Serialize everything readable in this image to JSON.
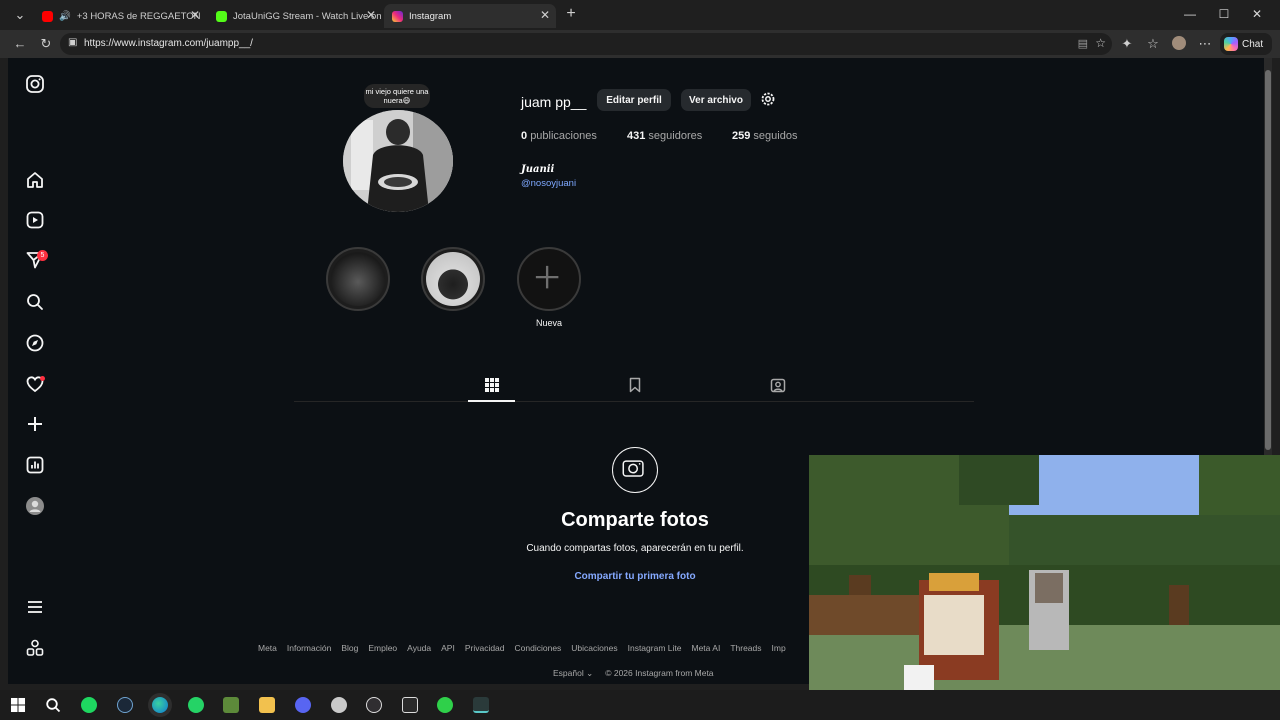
{
  "browser": {
    "tabs": [
      {
        "title": "+3 HORAS de REGGAETON",
        "active": false
      },
      {
        "title": "JotaUniGG Stream - Watch Live on",
        "active": false
      },
      {
        "title": "Instagram",
        "active": true
      }
    ],
    "url": "https://www.instagram.com/juampp__/",
    "chat_label": "Chat"
  },
  "sidebar": {
    "notification_count": "5",
    "items": [
      "instagram-logo",
      "home",
      "reels",
      "messages",
      "search",
      "explore",
      "notifications",
      "create",
      "dashboard",
      "profile",
      "more",
      "also-from-meta"
    ]
  },
  "profile": {
    "note": "mi viejo quiere una nuera😄",
    "username": "juam pp__",
    "edit_label": "Editar perfil",
    "archive_label": "Ver archivo",
    "stats": {
      "posts_count": "0",
      "posts_label": "publicaciones",
      "followers_count": "431",
      "followers_label": "seguidores",
      "following_count": "259",
      "following_label": "seguidos"
    },
    "full_name": "𝑱𝒖𝒂𝒏𝒊𝒊",
    "handle": "@nosoyjuani"
  },
  "highlights": {
    "new_label": "Nueva"
  },
  "empty_state": {
    "title": "Comparte fotos",
    "subtitle": "Cuando compartas fotos, aparecerán en tu perfil.",
    "link": "Compartir tu primera foto"
  },
  "footer": {
    "links": [
      "Meta",
      "Información",
      "Blog",
      "Empleo",
      "Ayuda",
      "API",
      "Privacidad",
      "Condiciones",
      "Ubicaciones",
      "Instagram Lite",
      "Meta AI",
      "Threads",
      "Imp"
    ],
    "language": "Español",
    "copyright": "© 2026 Instagram from Meta"
  },
  "colors": {
    "page_bg": "#0c1014",
    "link_blue": "#85a9ff",
    "badge_red": "#ff3040"
  }
}
